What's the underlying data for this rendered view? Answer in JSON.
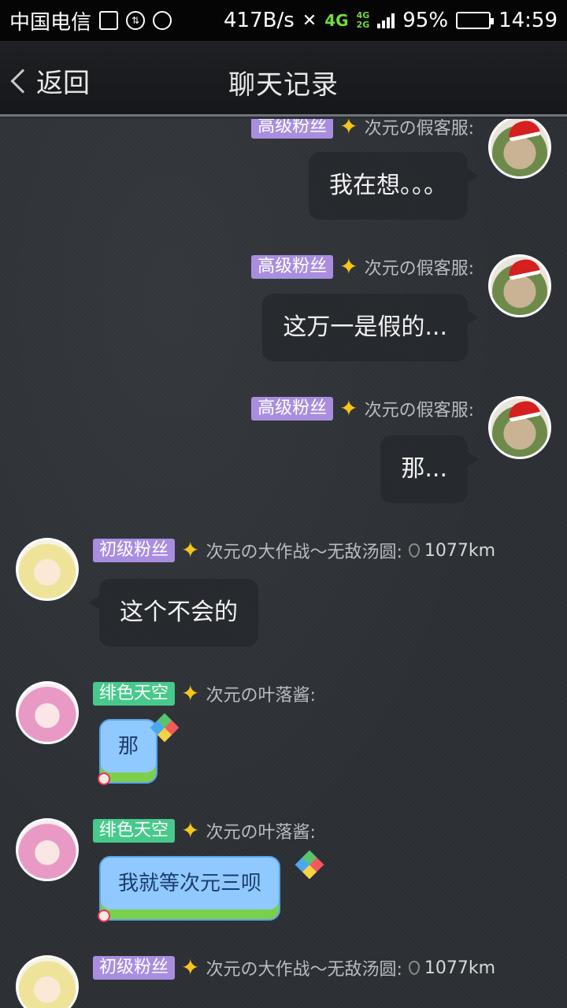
{
  "status_bar": {
    "carrier": "中国电信",
    "speed": "417B/s",
    "network_4g": "4G",
    "network_4g_small": "4G",
    "network_2g_small": "2G",
    "battery": "95%",
    "time": "14:59"
  },
  "header": {
    "back_label": "返回",
    "title": "聊天记录"
  },
  "messages": [
    {
      "badge": "高级粉丝",
      "sender": "次元の假客服:",
      "text": "我在想。。。"
    },
    {
      "badge": "高级粉丝",
      "sender": "次元の假客服:",
      "text": "这万一是假的..."
    },
    {
      "badge": "高级粉丝",
      "sender": "次元の假客服:",
      "text": "那..."
    },
    {
      "badge": "初级粉丝",
      "sender": "次元の大作战～无敌汤圆:",
      "distance": "1077km",
      "text": "这个不会的"
    },
    {
      "badge": "绯色天空",
      "sender": "次元の叶落酱:",
      "text": "那"
    },
    {
      "badge": "绯色天空",
      "sender": "次元の叶落酱:",
      "text": "我就等次元三呗"
    },
    {
      "badge": "初级粉丝",
      "sender": "次元の大作战～无敌汤圆:",
      "distance": "1077km"
    }
  ],
  "colors": {
    "badge_purple": "#a98ee0",
    "badge_green": "#47c98b",
    "star": "#f7c61a"
  }
}
